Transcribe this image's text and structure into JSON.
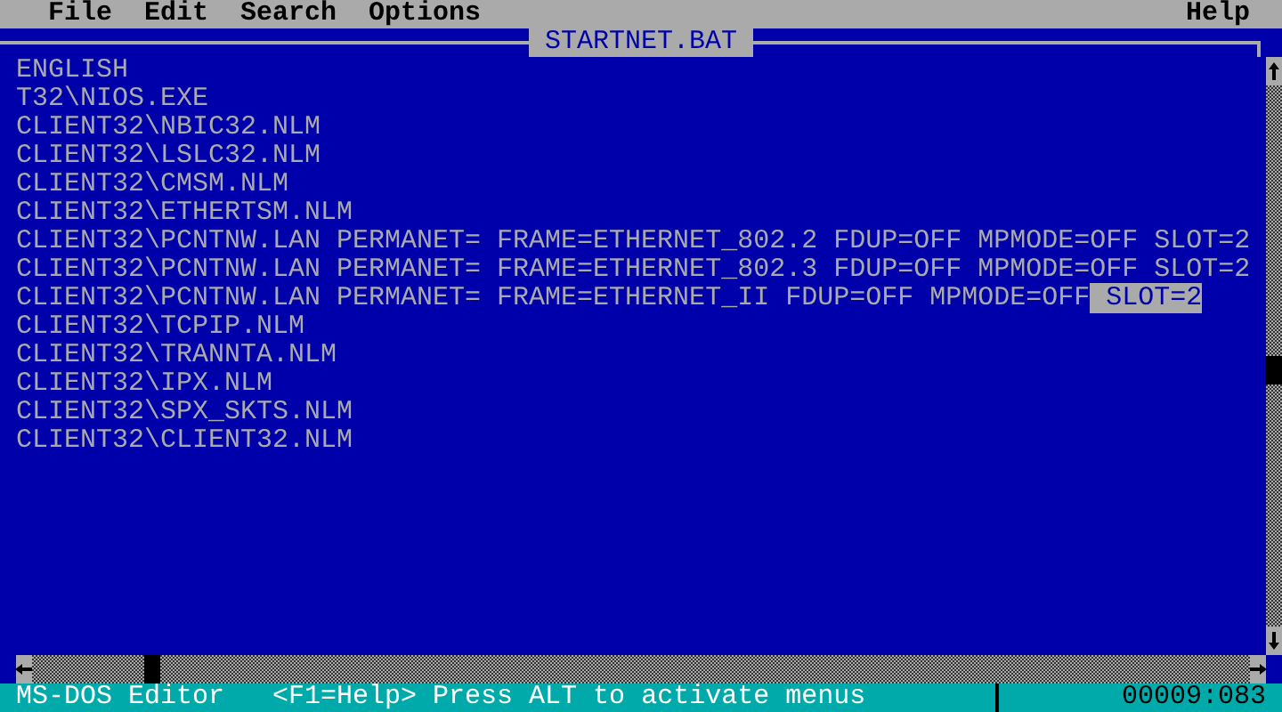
{
  "menu_bar": {
    "items": [
      "File",
      "Edit",
      "Search",
      "Options"
    ],
    "help": "Help"
  },
  "document": {
    "title": "STARTNET.BAT",
    "lines": [
      {
        "text": "ENGLISH"
      },
      {
        "text": "T32\\NIOS.EXE"
      },
      {
        "text": "CLIENT32\\NBIC32.NLM"
      },
      {
        "text": "CLIENT32\\LSLC32.NLM"
      },
      {
        "text": "CLIENT32\\CMSM.NLM"
      },
      {
        "text": "CLIENT32\\ETHERTSM.NLM"
      },
      {
        "text": "CLIENT32\\PCNTNW.LAN PERMANET= FRAME=ETHERNET_802.2 FDUP=OFF MPMODE=OFF SLOT=2"
      },
      {
        "text": "CLIENT32\\PCNTNW.LAN PERMANET= FRAME=ETHERNET_802.3 FDUP=OFF MPMODE=OFF SLOT=2"
      },
      {
        "text": "CLIENT32\\PCNTNW.LAN PERMANET= FRAME=ETHERNET_II FDUP=OFF MPMODE=OFF",
        "selected_text": " SLOT=2"
      },
      {
        "text": "CLIENT32\\TCPIP.NLM"
      },
      {
        "text": "CLIENT32\\TRANNTA.NLM"
      },
      {
        "text": "CLIENT32\\IPX.NLM"
      },
      {
        "text": "CLIENT32\\SPX_SKTS.NLM"
      },
      {
        "text": "CLIENT32\\CLIENT32.NLM"
      }
    ]
  },
  "status_bar": {
    "app_name": "MS-DOS Editor",
    "hint": "<F1=Help> Press ALT to activate menus",
    "position": "00009:083"
  }
}
